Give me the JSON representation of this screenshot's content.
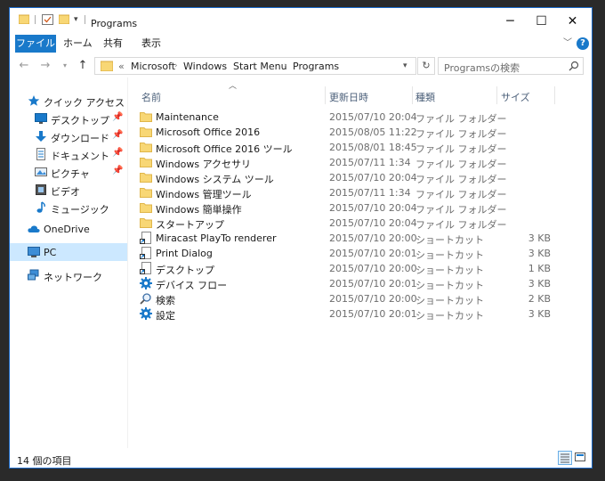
{
  "window": {
    "title": "Programs",
    "controls": {
      "minimize": "─",
      "maximize": "☐",
      "close": "✕"
    }
  },
  "ribbon": {
    "tabs": [
      "ファイル",
      "ホーム",
      "共有",
      "表示"
    ],
    "help": "?"
  },
  "address": {
    "crumbs": [
      "«",
      "Microsoft",
      "Windows",
      "Start Menu",
      "Programs"
    ],
    "search_placeholder": "Programsの検索"
  },
  "nav": {
    "quick_access": "クイック アクセス",
    "items": [
      {
        "label": "デスクトップ",
        "icon": "desktop-icon",
        "pinned": true
      },
      {
        "label": "ダウンロード",
        "icon": "download-icon",
        "pinned": true
      },
      {
        "label": "ドキュメント",
        "icon": "document-icon",
        "pinned": true
      },
      {
        "label": "ピクチャ",
        "icon": "picture-icon",
        "pinned": true
      },
      {
        "label": "ビデオ",
        "icon": "video-icon",
        "pinned": false
      },
      {
        "label": "ミュージック",
        "icon": "music-icon",
        "pinned": false
      }
    ],
    "onedrive": "OneDrive",
    "pc": "PC",
    "network": "ネットワーク"
  },
  "columns": {
    "name": "名前",
    "date": "更新日時",
    "type": "種類",
    "size": "サイズ"
  },
  "files": [
    {
      "name": "Maintenance",
      "date": "2015/07/10 20:04",
      "type": "ファイル フォルダー",
      "size": "",
      "icon": "folder"
    },
    {
      "name": "Microsoft Office 2016",
      "date": "2015/08/05 11:22",
      "type": "ファイル フォルダー",
      "size": "",
      "icon": "folder"
    },
    {
      "name": "Microsoft Office 2016 ツール",
      "date": "2015/08/01 18:45",
      "type": "ファイル フォルダー",
      "size": "",
      "icon": "folder"
    },
    {
      "name": "Windows アクセサリ",
      "date": "2015/07/11 1:34",
      "type": "ファイル フォルダー",
      "size": "",
      "icon": "folder"
    },
    {
      "name": "Windows システム ツール",
      "date": "2015/07/10 20:04",
      "type": "ファイル フォルダー",
      "size": "",
      "icon": "folder"
    },
    {
      "name": "Windows 管理ツール",
      "date": "2015/07/11 1:34",
      "type": "ファイル フォルダー",
      "size": "",
      "icon": "folder"
    },
    {
      "name": "Windows 簡単操作",
      "date": "2015/07/10 20:04",
      "type": "ファイル フォルダー",
      "size": "",
      "icon": "folder"
    },
    {
      "name": "スタートアップ",
      "date": "2015/07/10 20:04",
      "type": "ファイル フォルダー",
      "size": "",
      "icon": "folder"
    },
    {
      "name": "Miracast PlayTo renderer",
      "date": "2015/07/10 20:00",
      "type": "ショートカット",
      "size": "3 KB",
      "icon": "shortcut"
    },
    {
      "name": "Print Dialog",
      "date": "2015/07/10 20:01",
      "type": "ショートカット",
      "size": "3 KB",
      "icon": "shortcut"
    },
    {
      "name": "デスクトップ",
      "date": "2015/07/10 20:00",
      "type": "ショートカット",
      "size": "1 KB",
      "icon": "shortcut"
    },
    {
      "name": "デバイス フロー",
      "date": "2015/07/10 20:01",
      "type": "ショートカット",
      "size": "3 KB",
      "icon": "gear"
    },
    {
      "name": "検索",
      "date": "2015/07/10 20:00",
      "type": "ショートカット",
      "size": "2 KB",
      "icon": "search"
    },
    {
      "name": "設定",
      "date": "2015/07/10 20:01",
      "type": "ショートカット",
      "size": "3 KB",
      "icon": "gear"
    }
  ],
  "status": {
    "count": "14 個の項目"
  },
  "colors": {
    "accent": "#1979ca",
    "selected_nav": "#cce8ff",
    "folder": "#f8d775"
  }
}
